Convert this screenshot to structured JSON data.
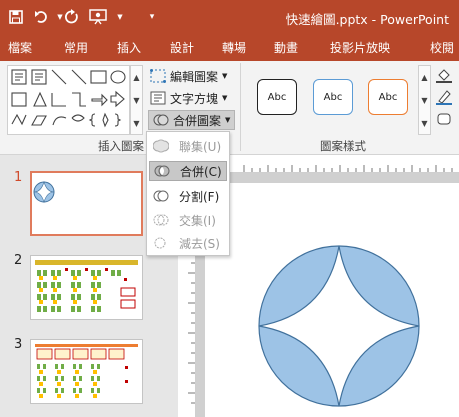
{
  "window": {
    "title": "快速繪圖.pptx - PowerPoint"
  },
  "quick_access": {
    "save_icon": "save-icon",
    "undo_icon": "undo-icon",
    "redo_icon": "redo-icon",
    "present_icon": "present-from-start-icon",
    "customize_icon": "customize-icon"
  },
  "tabs": [
    "檔案",
    "常用",
    "插入",
    "設計",
    "轉場",
    "動畫",
    "投影片放映",
    "校閱"
  ],
  "ribbon": {
    "edit_shape": "編輯圖案",
    "text_box": "文字方塊",
    "merge_shapes": "合併圖案",
    "group_insert_shapes": "插入圖案",
    "group_shape_styles": "圖案樣式",
    "style_samples": [
      "Abc",
      "Abc",
      "Abc"
    ],
    "style_colors": [
      "#222222",
      "#5b9bd5",
      "#ed7d31"
    ]
  },
  "merge_menu": {
    "items": [
      {
        "label": "聯集(U)",
        "enabled": false
      },
      {
        "label": "合併(C)",
        "enabled": true,
        "highlighted": true
      },
      {
        "label": "分割(F)",
        "enabled": true
      },
      {
        "label": "交集(I)",
        "enabled": false
      },
      {
        "label": "減去(S)",
        "enabled": false
      }
    ]
  },
  "slides": [
    "1",
    "2",
    "3"
  ],
  "canvas": {
    "shape_fill": "#9dc3e6",
    "shape_stroke": "#41719c"
  },
  "colors": {
    "accent": "#b7472a",
    "selected_thumb": "#e07b5c"
  }
}
